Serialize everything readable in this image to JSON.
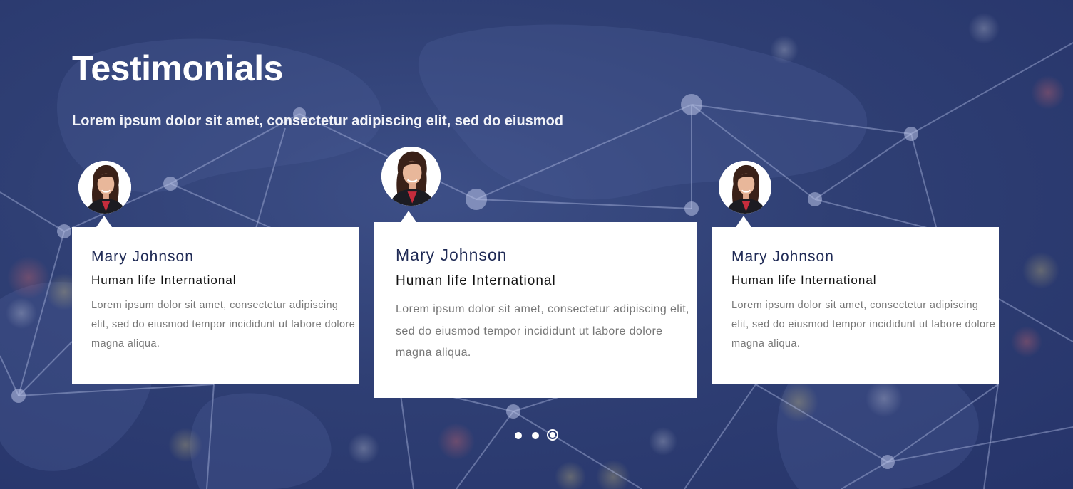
{
  "section": {
    "title": "Testimonials",
    "subtitle": "Lorem ipsum dolor sit amet, consectetur adipiscing elit, sed do eiusmod"
  },
  "testimonials": [
    {
      "name": "Mary Johnson",
      "organization": "Human life International",
      "text": "Lorem ipsum dolor sit amet, consectetur adipiscing elit, sed do eiusmod tempor incididunt ut labore dolore magna aliqua.",
      "avatar_icon": "woman-portrait-icon"
    },
    {
      "name": "Mary Johnson",
      "organization": "Human life International",
      "text": "Lorem ipsum dolor sit amet, consectetur adipiscing elit, sed do eiusmod tempor incididunt ut labore dolore magna aliqua.",
      "avatar_icon": "woman-portrait-icon"
    },
    {
      "name": "Mary Johnson",
      "organization": "Human life International",
      "text": "Lorem ipsum dolor sit amet, consectetur adipiscing elit, sed do eiusmod tempor incididunt ut labore dolore magna aliqua.",
      "avatar_icon": "woman-portrait-icon"
    }
  ],
  "pagination": {
    "count": 3,
    "active_index": 2
  },
  "colors": {
    "background": "#2f3f74",
    "card": "#ffffff",
    "name_text": "#1f2a55",
    "body_text": "#777777"
  }
}
